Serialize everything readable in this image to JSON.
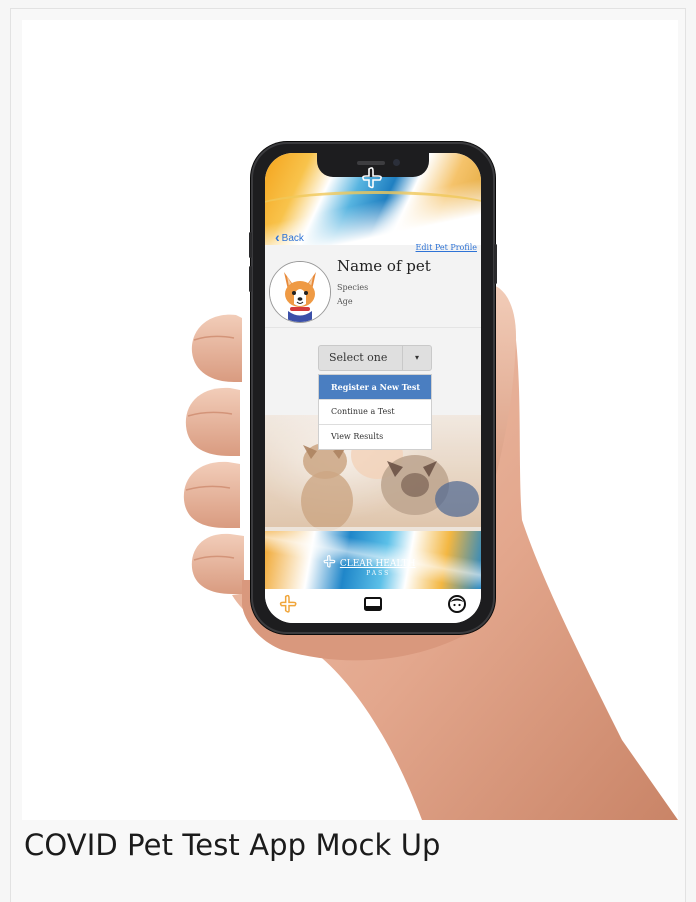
{
  "caption": "COVID Pet Test App Mock Up",
  "app": {
    "logo_text": "",
    "back_label": "Back",
    "edit_profile_label": "Edit Pet Profile",
    "pet": {
      "name": "Name of pet",
      "species": "Species",
      "age": "Age"
    },
    "select": {
      "label": "Select one",
      "caret": "▾",
      "options": [
        {
          "label": "Register a New Test",
          "active": true
        },
        {
          "label": "Continue a Test",
          "active": false
        },
        {
          "label": "View Results",
          "active": false
        }
      ]
    },
    "brand": {
      "name": "CLEAR HEALTH",
      "sub": "PASS"
    },
    "tabbar": {
      "items": [
        "health-cross-icon",
        "tablet-icon",
        "profile-face-icon"
      ]
    },
    "colors": {
      "link": "#2e73d6",
      "active_option": "#4a7ec1",
      "brand_orange": "#f4a31c",
      "brand_blue": "#1f7fc1"
    }
  }
}
